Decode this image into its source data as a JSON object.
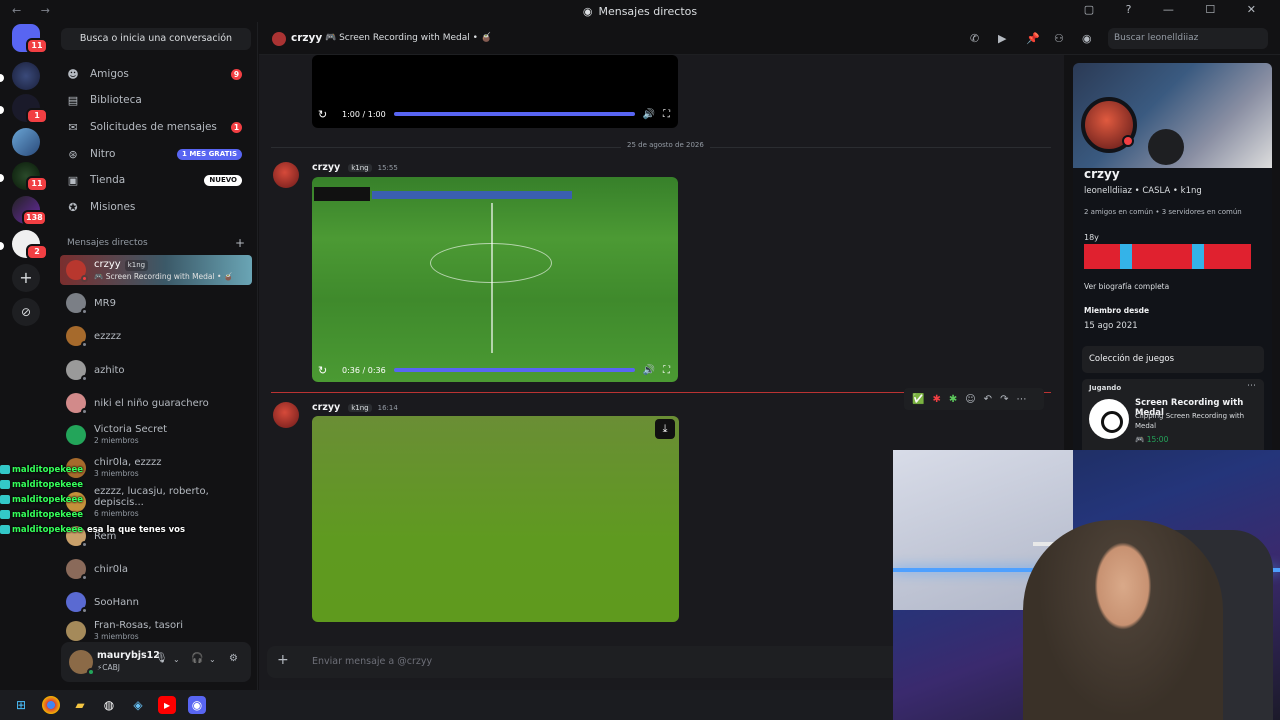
{
  "window": {
    "title": "Mensajes directos",
    "nav_arrows": "← →",
    "controls": "▢ ? — ☐ ✕"
  },
  "rail": {
    "badges": [
      "11",
      "1",
      "11",
      "138",
      "2"
    ]
  },
  "sidebar": {
    "search_label": "Busca o inicia una conversación",
    "nav": [
      {
        "label": "Amigos",
        "badge": "9"
      },
      {
        "label": "Biblioteca"
      },
      {
        "label": "Solicitudes de mensajes",
        "badge": "1"
      },
      {
        "label": "Nitro",
        "pill": "1 MES GRATIS"
      },
      {
        "label": "Tienda",
        "pill": "NUEVO"
      },
      {
        "label": "Misiones"
      }
    ],
    "dm_header": "Mensajes directos",
    "dms": [
      {
        "name": "crzyy",
        "tag": "k1ng",
        "sub": "🎮 Screen Recording with Medal • 🧉",
        "color": "#b8372e"
      },
      {
        "name": "MR9",
        "sub": "",
        "color": "#7b7f86"
      },
      {
        "name": "ezzzz",
        "sub": "",
        "color": "#a66a2c"
      },
      {
        "name": "azhito",
        "sub": "",
        "color": "#9a9a9a"
      },
      {
        "name": "niki el niño guarachero",
        "sub": "",
        "color": "#d28a8a"
      },
      {
        "name": "Victoria Secret",
        "sub": "2 miembros",
        "color": "#23a55a"
      },
      {
        "name": "chir0la, ezzzz",
        "sub": "3 miembros",
        "color": "#a66a2c"
      },
      {
        "name": "ezzzz, lucasju, roberto, depiscis...",
        "sub": "6 miembros",
        "color": "#c5913b"
      },
      {
        "name": "Rem",
        "sub": "",
        "color": "#c9a06a"
      },
      {
        "name": "chir0la",
        "sub": "",
        "color": "#8a6a5a"
      },
      {
        "name": "SooHann",
        "sub": "",
        "color": "#5a6ad2"
      },
      {
        "name": "Fran-Rosas, tasori",
        "sub": "3 miembros",
        "color": "#a58a5a"
      }
    ],
    "user": {
      "name": "maurybjs12",
      "status": "⚡CABJ"
    }
  },
  "header": {
    "name": "crzyy",
    "activity": "🎮 Screen Recording with Medal • 🧉",
    "search_placeholder": "Buscar leonelldiiaz"
  },
  "chat": {
    "video1_time": "1:00 / 1:00",
    "date_divider": "25 de agosto de 2026",
    "msg1": {
      "name": "crzyy",
      "tag": "k1ng",
      "time": "15:55",
      "video_time": "0:36 / 0:36"
    },
    "msg2": {
      "name": "crzyy",
      "tag": "k1ng",
      "time": "16:14"
    },
    "input_placeholder": "Enviar mensaje a @crzyy"
  },
  "profile": {
    "name": "crzyy",
    "username_line": "leonelldiiaz • CASLA • k1ng",
    "mutual": "2 amigos en común • 3 servidores en común",
    "age": "18y",
    "bio_link": "Ver biografía completa",
    "member_since_label": "Miembro desde",
    "member_since": "15 ago 2021",
    "games_label": "Colección de juegos",
    "playing_label": "Jugando",
    "game_name": "Screen Recording with Medal",
    "game_desc": "Clipping Screen Recording with Medal",
    "game_time": "🎮 15:00"
  },
  "overlay": [
    {
      "user": "malditopekeee",
      "msg": ""
    },
    {
      "user": "malditopekeee",
      "msg": ""
    },
    {
      "user": "malditopekeee",
      "msg": ""
    },
    {
      "user": "malditopekeee",
      "msg": ""
    },
    {
      "user": "malditopekeee",
      "msg": "esa la que tenes vos"
    }
  ],
  "colors": {
    "accent": "#5865f2",
    "danger": "#f23f43",
    "online": "#23a55a"
  }
}
